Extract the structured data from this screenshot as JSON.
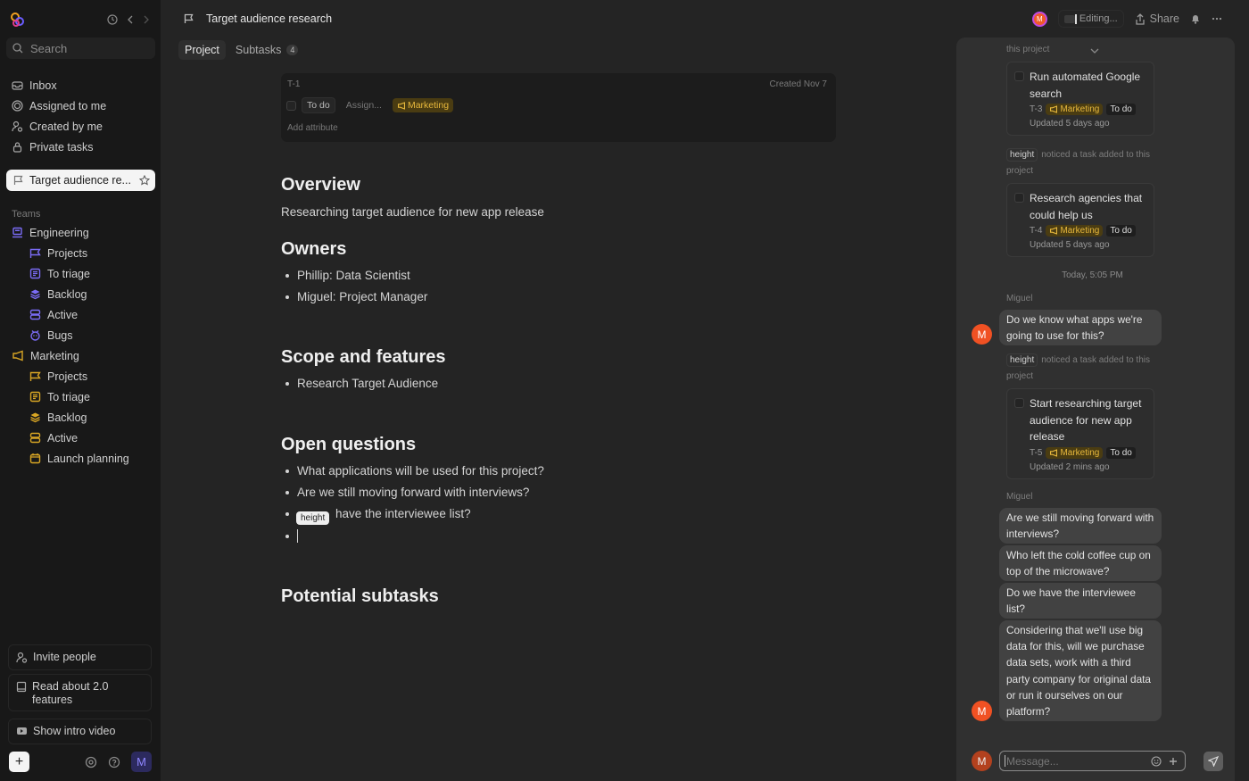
{
  "app": {
    "title": "Target audience research"
  },
  "sidebar": {
    "search_placeholder": "Search",
    "nav": [
      {
        "label": "Inbox",
        "icon": "inbox-icon"
      },
      {
        "label": "Assigned to me",
        "icon": "target-icon"
      },
      {
        "label": "Created by me",
        "icon": "user-created-icon"
      },
      {
        "label": "Private tasks",
        "icon": "lock-icon"
      }
    ],
    "pinned": {
      "label": "Target audience re...",
      "icon": "flag-icon"
    },
    "teams_label": "Teams",
    "teams": [
      {
        "label": "Engineering",
        "color": "#7b6cf6",
        "items": [
          "Projects",
          "To triage",
          "Backlog",
          "Active",
          "Bugs"
        ]
      },
      {
        "label": "Marketing",
        "color": "#d9a624",
        "items": [
          "Projects",
          "To triage",
          "Backlog",
          "Active",
          "Launch planning"
        ]
      }
    ],
    "bottom": {
      "invite": "Invite people",
      "read": "Read about 2.0 features",
      "video": "Show intro video",
      "add": "+",
      "avatar": "M"
    }
  },
  "header": {
    "title": "Target audience research",
    "avatar": "M",
    "editing": "Editing...",
    "share": "Share"
  },
  "tabs": [
    {
      "label": "Project",
      "active": true
    },
    {
      "label": "Subtasks",
      "badge": "4"
    }
  ],
  "task": {
    "id": "T-1",
    "created": "Created Nov 7",
    "status": "To do",
    "assign": "Assign...",
    "team": "Marketing",
    "add_attribute": "Add attribute"
  },
  "doc": {
    "overview_h": "Overview",
    "overview_p": "Researching target audience for new app release",
    "owners_h": "Owners",
    "owners": [
      "Phillip: Data Scientist",
      "Miguel: Project Manager"
    ],
    "scope_h": "Scope and features",
    "scope": [
      "Research Target Audience"
    ],
    "questions_h": "Open questions",
    "questions": [
      "What applications will be used for this project?",
      "Are we still moving forward with interviews?",
      "Do we have the interviewee list?",
      ""
    ],
    "questions_visible_3": "have the interviewee list?",
    "tooltip": "height",
    "subtasks_h": "Potential subtasks"
  },
  "chat": {
    "top_sys": "this project",
    "tasks": [
      {
        "title": "Run automated Google search",
        "id": "T-3",
        "team": "Marketing",
        "status": "To do",
        "updated": "Updated 5 days ago"
      },
      {
        "title": "Research agencies that could help us",
        "id": "T-4",
        "team": "Marketing",
        "status": "To do",
        "updated": "Updated 5 days ago"
      },
      {
        "title": "Start researching target audience for new app release",
        "id": "T-5",
        "team": "Marketing",
        "status": "To do",
        "updated": "Updated 2 mins ago"
      }
    ],
    "sys_bot": "height",
    "sys_text": "noticed a task added to this project",
    "time_sep": "Today, 5:05 PM",
    "sender": "Miguel",
    "avatar": "M",
    "msg1": "Do we know what apps we're going to use for this?",
    "msgs": [
      "Are we still moving forward with interviews?",
      "Who left the cold coffee cup on top of the microwave?",
      "Do we have the interviewee list?",
      "Considering that we'll use big data for this, will we purchase data sets, work with a third party company for original data or run it ourselves on our platform?"
    ],
    "input_placeholder": "Message..."
  }
}
